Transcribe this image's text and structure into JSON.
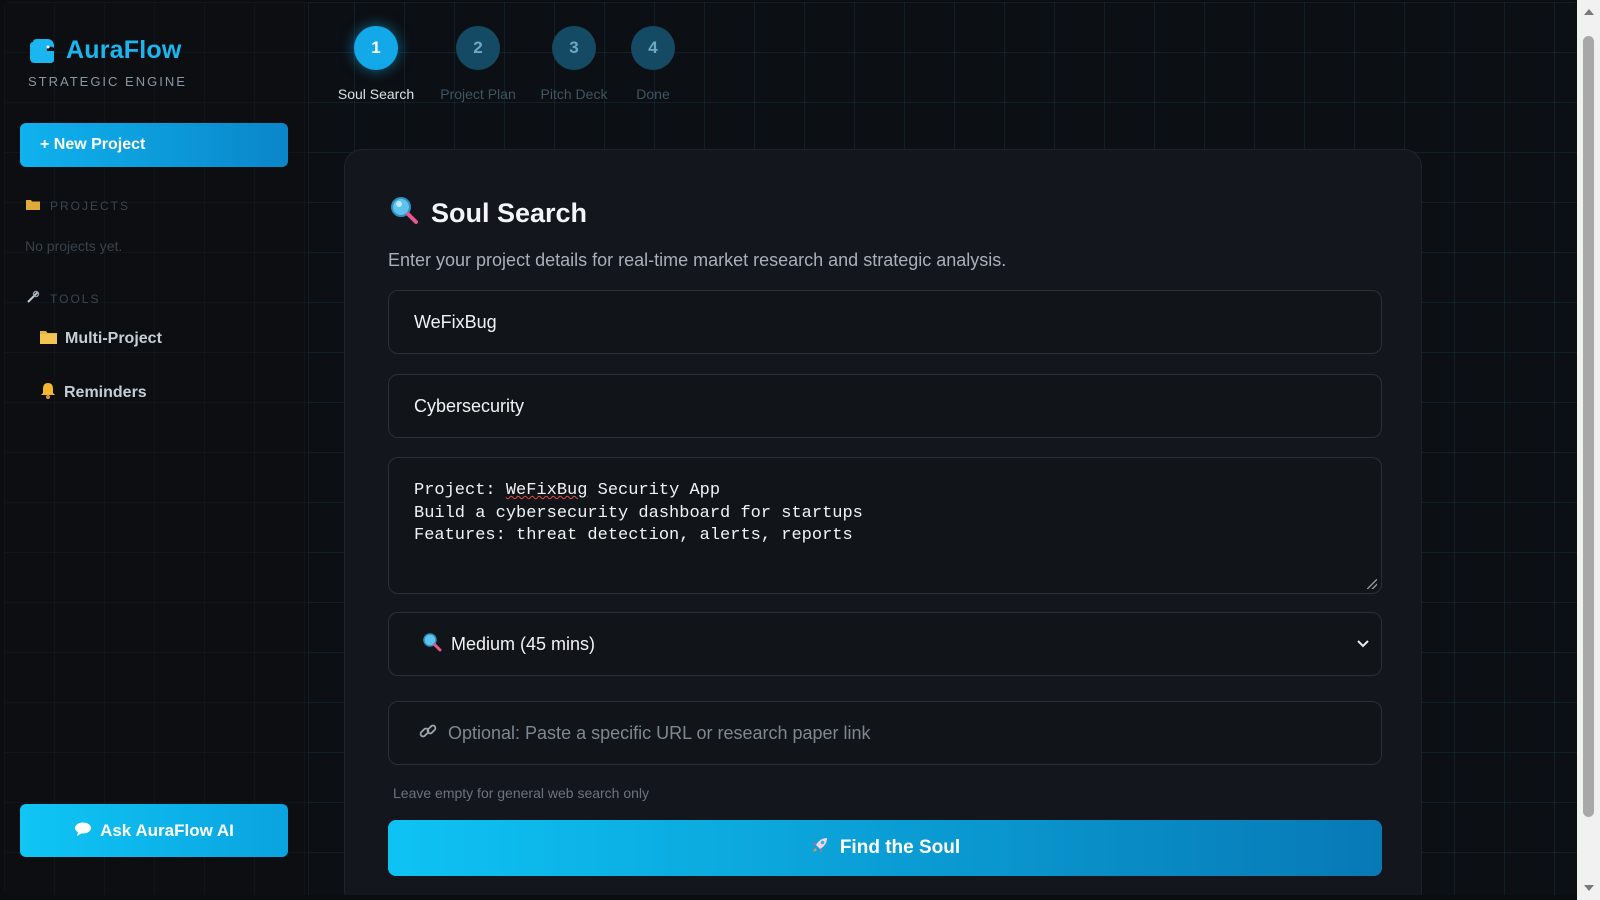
{
  "sidebar": {
    "brand_name": "AuraFlow",
    "brand_subtitle": "STRATEGIC ENGINE",
    "new_project_label": "+ New Project",
    "projects_heading": "PROJECTS",
    "projects_empty": "No projects yet.",
    "tools_heading": "TOOLS",
    "tools": [
      {
        "label": "Multi-Project",
        "icon": "folder-icon"
      },
      {
        "label": "Reminders",
        "icon": "bell-icon"
      }
    ],
    "ask_ai_label": "Ask AuraFlow AI"
  },
  "stepper": {
    "steps": [
      {
        "number": "1",
        "label": "Soul Search",
        "active": true
      },
      {
        "number": "2",
        "label": "Project Plan",
        "active": false
      },
      {
        "number": "3",
        "label": "Pitch Deck",
        "active": false
      },
      {
        "number": "4",
        "label": "Done",
        "active": false
      }
    ]
  },
  "card": {
    "title": "Soul Search",
    "description": "Enter your project details for real-time market research and strategic analysis.",
    "project_name_value": "WeFixBug",
    "industry_value": "Cybersecurity",
    "details_lines": {
      "line1_prefix": "Project: ",
      "line1_word": "WeFixBug",
      "line1_suffix": " Security App",
      "line2": "Build a cybersecurity dashboard for startups",
      "line3": "Features: threat detection, alerts, reports"
    },
    "depth_selected": "Medium (45 mins)",
    "url_placeholder": "Optional: Paste a specific URL or research paper link",
    "helper_text": "Leave empty for general web search only",
    "submit_label": "Find the Soul"
  },
  "colors": {
    "accent": "#13a9e8",
    "brand": "#1ab6f0",
    "background": "#0c0f13"
  }
}
